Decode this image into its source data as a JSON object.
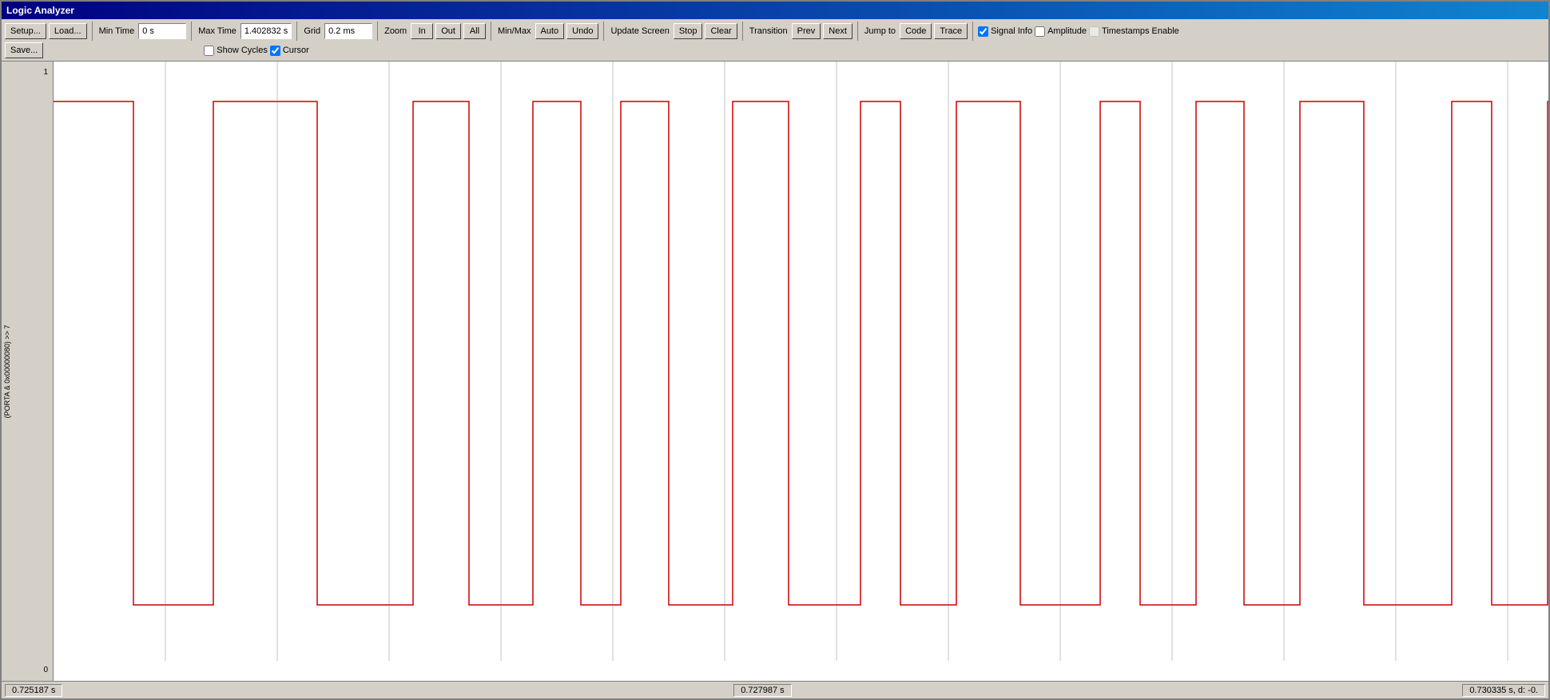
{
  "window": {
    "title": "Logic Analyzer"
  },
  "toolbar": {
    "setup_label": "Setup...",
    "load_label": "Load...",
    "save_label": "Save...",
    "min_time_label": "Min Time",
    "min_time_value": "0 s",
    "max_time_label": "Max Time",
    "max_time_value": "1.402832 s",
    "grid_label": "Grid",
    "grid_value": "0.2 ms",
    "zoom_label": "Zoom",
    "zoom_in_label": "In",
    "zoom_out_label": "Out",
    "zoom_all_label": "All",
    "minmax_label": "Min/Max",
    "minmax_auto_label": "Auto",
    "minmax_undo_label": "Undo",
    "update_screen_label": "Update Screen",
    "update_stop_label": "Stop",
    "update_clear_label": "Clear",
    "transition_label": "Transition",
    "transition_prev_label": "Prev",
    "transition_next_label": "Next",
    "jumpto_label": "Jump to",
    "jumpto_code_label": "Code",
    "jumpto_trace_label": "Trace",
    "signal_info_label": "Signal Info",
    "amplitude_label": "Amplitude",
    "timestamps_label": "Timestamps Enable",
    "show_cycles_label": "Show Cycles",
    "cursor_label": "Cursor",
    "signal_info_checked": true,
    "amplitude_checked": false,
    "timestamps_checked": false,
    "show_cycles_checked": false,
    "cursor_checked": true
  },
  "channel": {
    "label": "(PORTA & 0x00000080) >> 7",
    "scale_high": "1",
    "scale_low": "0"
  },
  "status": {
    "left_time": "0.725187 s",
    "center_time": "0.727987 s",
    "right_time": "0.730335 s,  d: -0."
  }
}
